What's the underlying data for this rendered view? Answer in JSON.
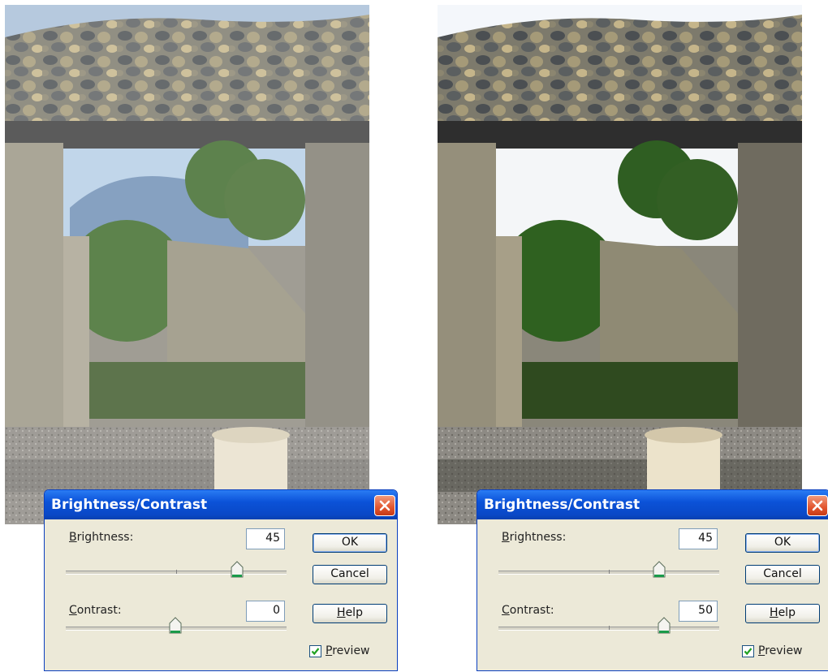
{
  "dialogs": [
    {
      "title": "Brightness/Contrast",
      "brightness_label_key": "B",
      "brightness_label_rest": "rightness:",
      "brightness_value": "45",
      "contrast_label_key": "C",
      "contrast_label_rest": "ontrast:",
      "contrast_value": "0",
      "ok_label": "OK",
      "cancel_label": "Cancel",
      "help_label_key": "H",
      "help_label_rest": "elp",
      "preview_label_key": "P",
      "preview_label_rest": "review",
      "preview_checked": true
    },
    {
      "title": "Brightness/Contrast",
      "brightness_label_key": "B",
      "brightness_label_rest": "rightness:",
      "brightness_value": "45",
      "contrast_label_key": "C",
      "contrast_label_rest": "ontrast:",
      "contrast_value": "50",
      "ok_label": "OK",
      "cancel_label": "Cancel",
      "help_label_key": "H",
      "help_label_rest": "elp",
      "preview_label_key": "P",
      "preview_label_rest": "review",
      "preview_checked": true
    }
  ],
  "colors": {
    "titlebar": "#0a48c6",
    "dialog_bg": "#ece9d8",
    "close_button": "#e2552e",
    "slider_thumb_accent": "#1a9a4a"
  }
}
